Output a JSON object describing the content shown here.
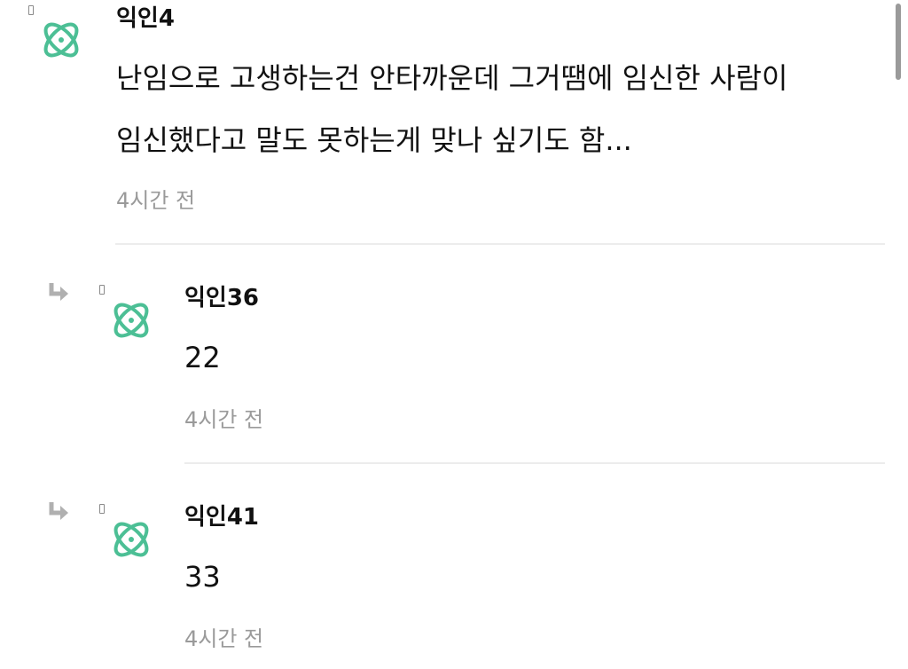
{
  "comments": [
    {
      "author": "익인4",
      "text_lines": [
        "난임으로 고생하는건 안타까운데 그거땜에 임신한 사람이",
        "임신했다고 말도 못하는게 맞나 싶기도 함..."
      ],
      "time": "4시간 전",
      "avatar_icon": "atom-icon",
      "is_reply": false
    },
    {
      "author": "익인36",
      "text": "22",
      "time": "4시간 전",
      "avatar_icon": "atom-icon",
      "is_reply": true,
      "reply_icon": "reply-arrow-icon"
    },
    {
      "author": "익인41",
      "text": "33",
      "time": "4시간 전",
      "avatar_icon": "atom-icon",
      "is_reply": true,
      "reply_icon": "reply-arrow-icon"
    }
  ],
  "colors": {
    "avatar": "#4cbf95",
    "time_text": "#9a9a9a",
    "divider": "#ececec"
  }
}
